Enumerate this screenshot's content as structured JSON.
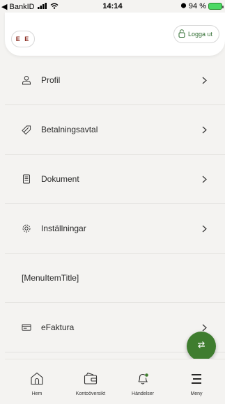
{
  "status_bar": {
    "back_app": "◀ BankID",
    "time": "14:14",
    "battery": "94 %"
  },
  "header": {
    "avatar_initials": "E E",
    "logout_label": "Logga ut"
  },
  "menu": {
    "items": [
      {
        "label": "Profil",
        "icon": "person-icon",
        "has_chevron": true
      },
      {
        "label": "Betalningsavtal",
        "icon": "tag-icon",
        "has_chevron": true
      },
      {
        "label": "Dokument",
        "icon": "document-icon",
        "has_chevron": true
      },
      {
        "label": "Inställningar",
        "icon": "gear-icon",
        "has_chevron": true
      },
      {
        "label": "[MenuItemTitle]",
        "icon": "",
        "has_chevron": false
      },
      {
        "label": "eFaktura",
        "icon": "invoice-icon",
        "has_chevron": true
      }
    ]
  },
  "fab": {
    "icon": "transfer-arrows-icon"
  },
  "bottom_nav": {
    "items": [
      {
        "label": "Hem",
        "icon": "home-icon"
      },
      {
        "label": "Kontoöversikt",
        "icon": "wallet-icon"
      },
      {
        "label": "Händelser",
        "icon": "bell-icon"
      },
      {
        "label": "Meny",
        "icon": "menu-icon"
      }
    ]
  },
  "colors": {
    "brand_green": "#3f7d2f",
    "avatar_text": "#8a2a1f",
    "background": "#f4f3f1"
  }
}
